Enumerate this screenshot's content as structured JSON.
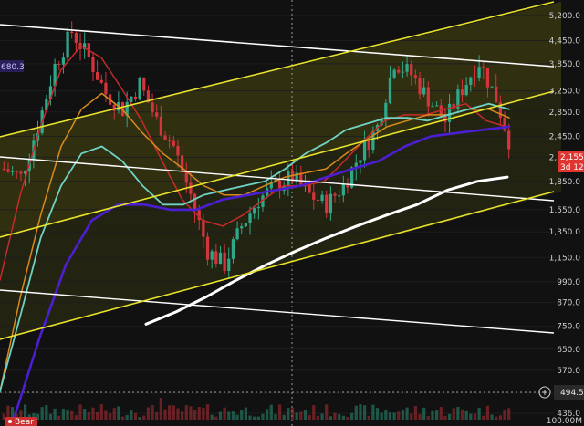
{
  "chart_data": {
    "type": "candlestick",
    "title": "",
    "price_axis": {
      "scale": "log",
      "ticks": [
        "5,200.0",
        "4,450.0",
        "3,850.0",
        "3,250.0",
        "2,850.0",
        "2,450.0",
        "2,150.0",
        "1,850.0",
        "1,550.0",
        "1,350.0",
        "1,150.0",
        "990.0",
        "870.0",
        "750.0",
        "650.0",
        "570.0",
        "494.5",
        "436.0"
      ],
      "range": [
        420,
        5600
      ]
    },
    "volume_axis": {
      "ticks": [
        "100.00M"
      ]
    },
    "current_price_label": {
      "value": "2,155.",
      "countdown": "3d 12h",
      "color": "#e0342f"
    },
    "volume_label": {
      "value": "494.5"
    },
    "left_label": {
      "value": "680.3"
    },
    "bottom_badge": {
      "text": "Bear"
    },
    "colors": {
      "background": "#111111",
      "up_candle": "#2fa88a",
      "down_candle": "#d4343c",
      "channel_line": "#e8e22b",
      "channel_fill": "#4a4a12",
      "white_line": "#ffffff",
      "sma_white": "#ffffff",
      "ema_blue": "#4b1fd1",
      "ma_teal": "#6fd3c4",
      "ma_orange": "#d98a1c",
      "ma_red": "#c72a2a"
    },
    "price_series": {
      "t": [
        0,
        4,
        8,
        12,
        16,
        20,
        24,
        28,
        32,
        36,
        40,
        44,
        48,
        52,
        56,
        60,
        64,
        68,
        72,
        76,
        80,
        84,
        88,
        92,
        96,
        100,
        104,
        108,
        112,
        116,
        120
      ],
      "close": [
        2000,
        1900,
        2600,
        3800,
        4700,
        4000,
        3200,
        2900,
        3400,
        2700,
        2300,
        1700,
        1200,
        1100,
        1400,
        1650,
        1800,
        1900,
        1700,
        1600,
        1800,
        2200,
        2600,
        3900,
        3600,
        3100,
        2700,
        3300,
        3900,
        3100,
        2200
      ]
    },
    "moving_averages": [
      {
        "name": "red",
        "values": [
          1000,
          1700,
          2600,
          3700,
          4300,
          4000,
          3300,
          2700,
          2100,
          1650,
          1450,
          1400,
          1500,
          1650,
          1800,
          1800,
          1850,
          2100,
          2400,
          2700,
          2800,
          2800,
          2900,
          3000,
          2700,
          2600
        ]
      },
      {
        "name": "orange",
        "values": [
          500,
          900,
          1500,
          2300,
          2900,
          3200,
          2900,
          2500,
          2200,
          2000,
          1800,
          1700,
          1700,
          1800,
          1900,
          1950,
          2000,
          2200,
          2400,
          2600,
          2700,
          2800,
          2800,
          2900,
          2900,
          2750
        ]
      },
      {
        "name": "teal",
        "values": [
          500,
          800,
          1300,
          1800,
          2200,
          2300,
          2100,
          1800,
          1600,
          1600,
          1700,
          1750,
          1800,
          1850,
          2000,
          2200,
          2350,
          2550,
          2650,
          2750,
          2750,
          2700,
          2800,
          2900,
          3000,
          2900
        ]
      },
      {
        "name": "blue",
        "values": [
          420,
          700,
          1100,
          1450,
          1600,
          1600,
          1550,
          1550,
          1650,
          1700,
          1750,
          1800,
          1900,
          2000,
          2100,
          2300,
          2450,
          2500,
          2550,
          2600
        ]
      },
      {
        "name": "white_sma",
        "values": [
          760,
          820,
          900,
          1000,
          1100,
          1200,
          1300,
          1400,
          1500,
          1600,
          1750,
          1850,
          1900
        ]
      }
    ]
  }
}
